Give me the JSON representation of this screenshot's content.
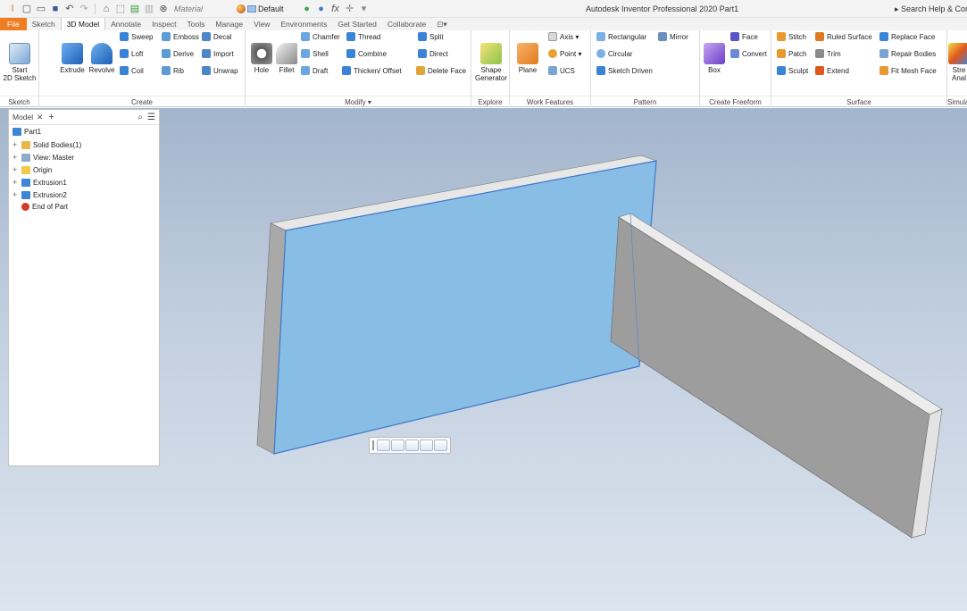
{
  "titlebar": {
    "material": "Material",
    "appearance": "Default",
    "app_title": "Autodesk Inventor Professional 2020   Part1",
    "search_help": "▸ Search Help & Com"
  },
  "tabs": [
    "File",
    "Sketch",
    "3D Model",
    "Annotate",
    "Inspect",
    "Tools",
    "Manage",
    "View",
    "Environments",
    "Get Started",
    "Collaborate",
    "⊡▾"
  ],
  "active_tab": "3D Model",
  "ribbon": {
    "sketch": {
      "start_label": "Start\n2D Sketch",
      "panel_label": "Sketch"
    },
    "create": {
      "panel_label": "Create",
      "big": [
        "Extrude",
        "Revolve"
      ],
      "small": [
        "Sweep",
        "Emboss",
        "Decal",
        "Loft",
        "Derive",
        "Import",
        "Coil",
        "Rib",
        "Unwrap"
      ]
    },
    "modify": {
      "panel_label": "Modify ▾",
      "big": [
        "Hole",
        "Fillet"
      ],
      "small": [
        "Chamfer",
        "Thread",
        "Split",
        "Shell",
        "Combine",
        "Direct",
        "Draft",
        "Thicken/ Offset",
        "Delete Face"
      ]
    },
    "explore": {
      "big": "Shape\nGenerator",
      "panel_label": "Explore"
    },
    "work_features": {
      "panel_label": "Work Features",
      "plane": "Plane",
      "small": [
        "Axis ▾",
        "Point ▾",
        "UCS"
      ]
    },
    "pattern": {
      "panel_label": "Pattern",
      "small": [
        "Rectangular",
        "Mirror",
        "Circular",
        "Sketch Driven"
      ]
    },
    "freeform": {
      "panel_label": "Create Freeform",
      "big": "Box",
      "small": [
        "Face",
        "Convert"
      ]
    },
    "surface": {
      "panel_label": "Surface",
      "small": [
        "Stitch",
        "Ruled Surface",
        "Replace Face",
        "Patch",
        "Trim",
        "Repair Bodies",
        "Sculpt",
        "Extend",
        "Fit Mesh Face"
      ]
    },
    "simulation": {
      "big": "Stre\nAnal",
      "panel_label": "Simula"
    }
  },
  "browser": {
    "title": "Model",
    "items": [
      {
        "label": "Part1",
        "color": "#3d86d6"
      },
      {
        "label": "Solid Bodies(1)",
        "color": "#e8b64a"
      },
      {
        "label": "View: Master",
        "color": "#8fa9c8"
      },
      {
        "label": "Origin",
        "color": "#f0c94b"
      },
      {
        "label": "Extrusion1",
        "color": "#3d86d6"
      },
      {
        "label": "Extrusion2",
        "color": "#3d86d6"
      },
      {
        "label": "End of Part",
        "color": "#d43a2a"
      }
    ]
  },
  "colors": {
    "accent": "#ef7d22",
    "selection": "#88bde6"
  }
}
